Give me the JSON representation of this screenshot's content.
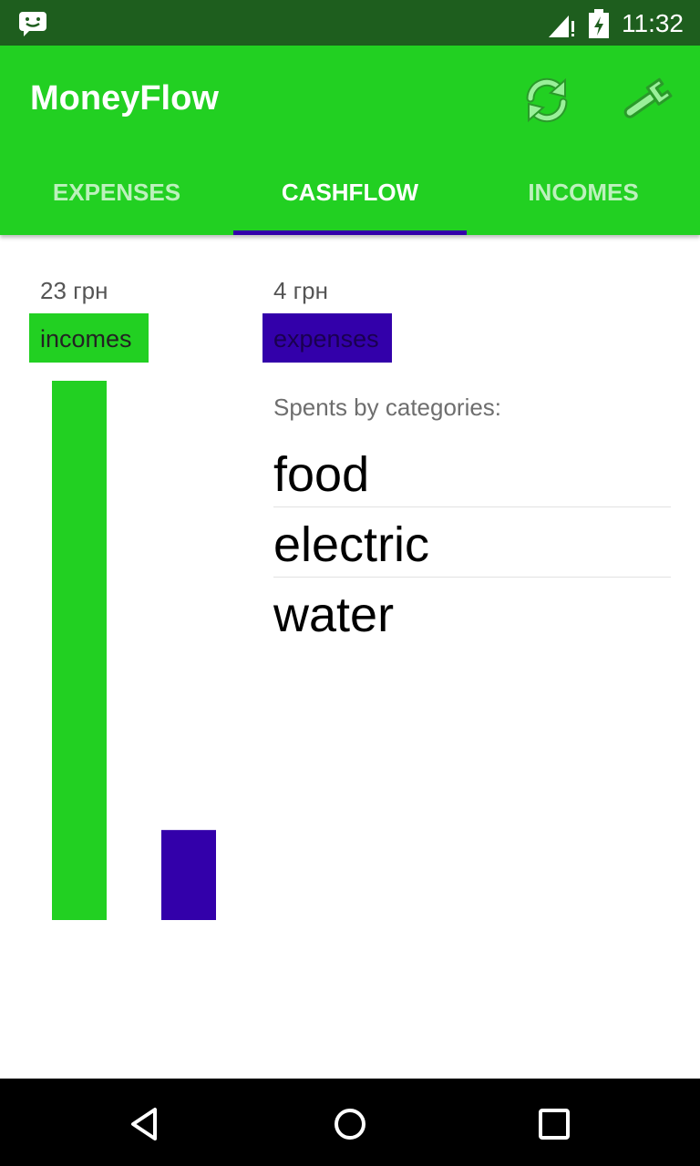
{
  "status_bar": {
    "time": "11:32",
    "icons": [
      "message-notification-icon",
      "signal-icon",
      "battery-icon"
    ]
  },
  "app_bar": {
    "title": "MoneyFlow",
    "actions": [
      "sync-icon",
      "settings-wrench-icon"
    ]
  },
  "tabs": [
    {
      "label": "EXPENSES",
      "active": false
    },
    {
      "label": "CASHFLOW",
      "active": true
    },
    {
      "label": "INCOMES",
      "active": false
    }
  ],
  "cashflow": {
    "incomes_amount": "23 грн",
    "expenses_amount": "4 грн",
    "incomes_label": "incomes",
    "expenses_label": "expenses"
  },
  "spents": {
    "heading": "Spents by categories:",
    "categories": [
      "food",
      "electric",
      "water"
    ]
  },
  "chart_data": {
    "type": "bar",
    "categories": [
      "incomes",
      "expenses"
    ],
    "values": [
      23,
      4
    ],
    "colors": [
      "#22d022",
      "#3300aa"
    ]
  },
  "colors": {
    "accent": "#22d022",
    "expense": "#3300aa",
    "status_bar": "#1e5e1e"
  },
  "nav_bar": {
    "icons": [
      "back-icon",
      "home-icon",
      "recents-icon"
    ]
  }
}
